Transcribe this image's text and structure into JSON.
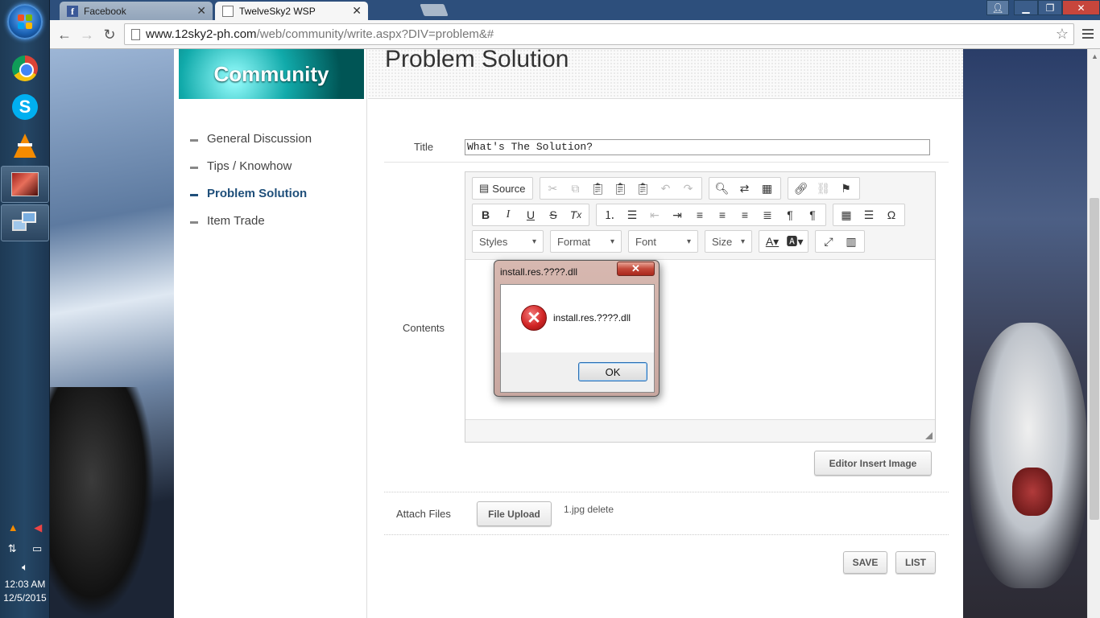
{
  "taskbar": {
    "apps": [
      "Google Chrome",
      "Skype",
      "VLC media player",
      "TwelveSky2",
      "Network"
    ],
    "clock_time": "12:03 AM",
    "clock_date": "12/5/2015"
  },
  "browser": {
    "tabs": [
      {
        "label": "Facebook",
        "active": false
      },
      {
        "label": "TwelveSky2 WSP",
        "active": true
      }
    ],
    "url_host": "www.12sky2-ph.com",
    "url_path": "/web/community/write.aspx?DIV=problem&#"
  },
  "sidebar": {
    "banner": "Community",
    "items": [
      {
        "label": "General Discussion"
      },
      {
        "label": "Tips / Knowhow"
      },
      {
        "label": "Problem Solution"
      },
      {
        "label": "Item Trade"
      }
    ]
  },
  "main": {
    "heading": "Problem Solution",
    "title_label": "Title",
    "title_value": "What's The Solution?",
    "contents_label": "Contents",
    "editor": {
      "source_label": "Source",
      "styles": "Styles",
      "format": "Format",
      "font": "Font",
      "size": "Size"
    },
    "insert_image_label": "Editor Insert Image",
    "attach_label": "Attach Files",
    "file_upload_label": "File Upload",
    "attached_file": "1.jpg delete",
    "save_label": "SAVE",
    "list_label": "LIST"
  },
  "dialog": {
    "title": "install.res.????.dll",
    "message": "install.res.????.dll",
    "ok_label": "OK",
    "icon": "error-icon"
  }
}
